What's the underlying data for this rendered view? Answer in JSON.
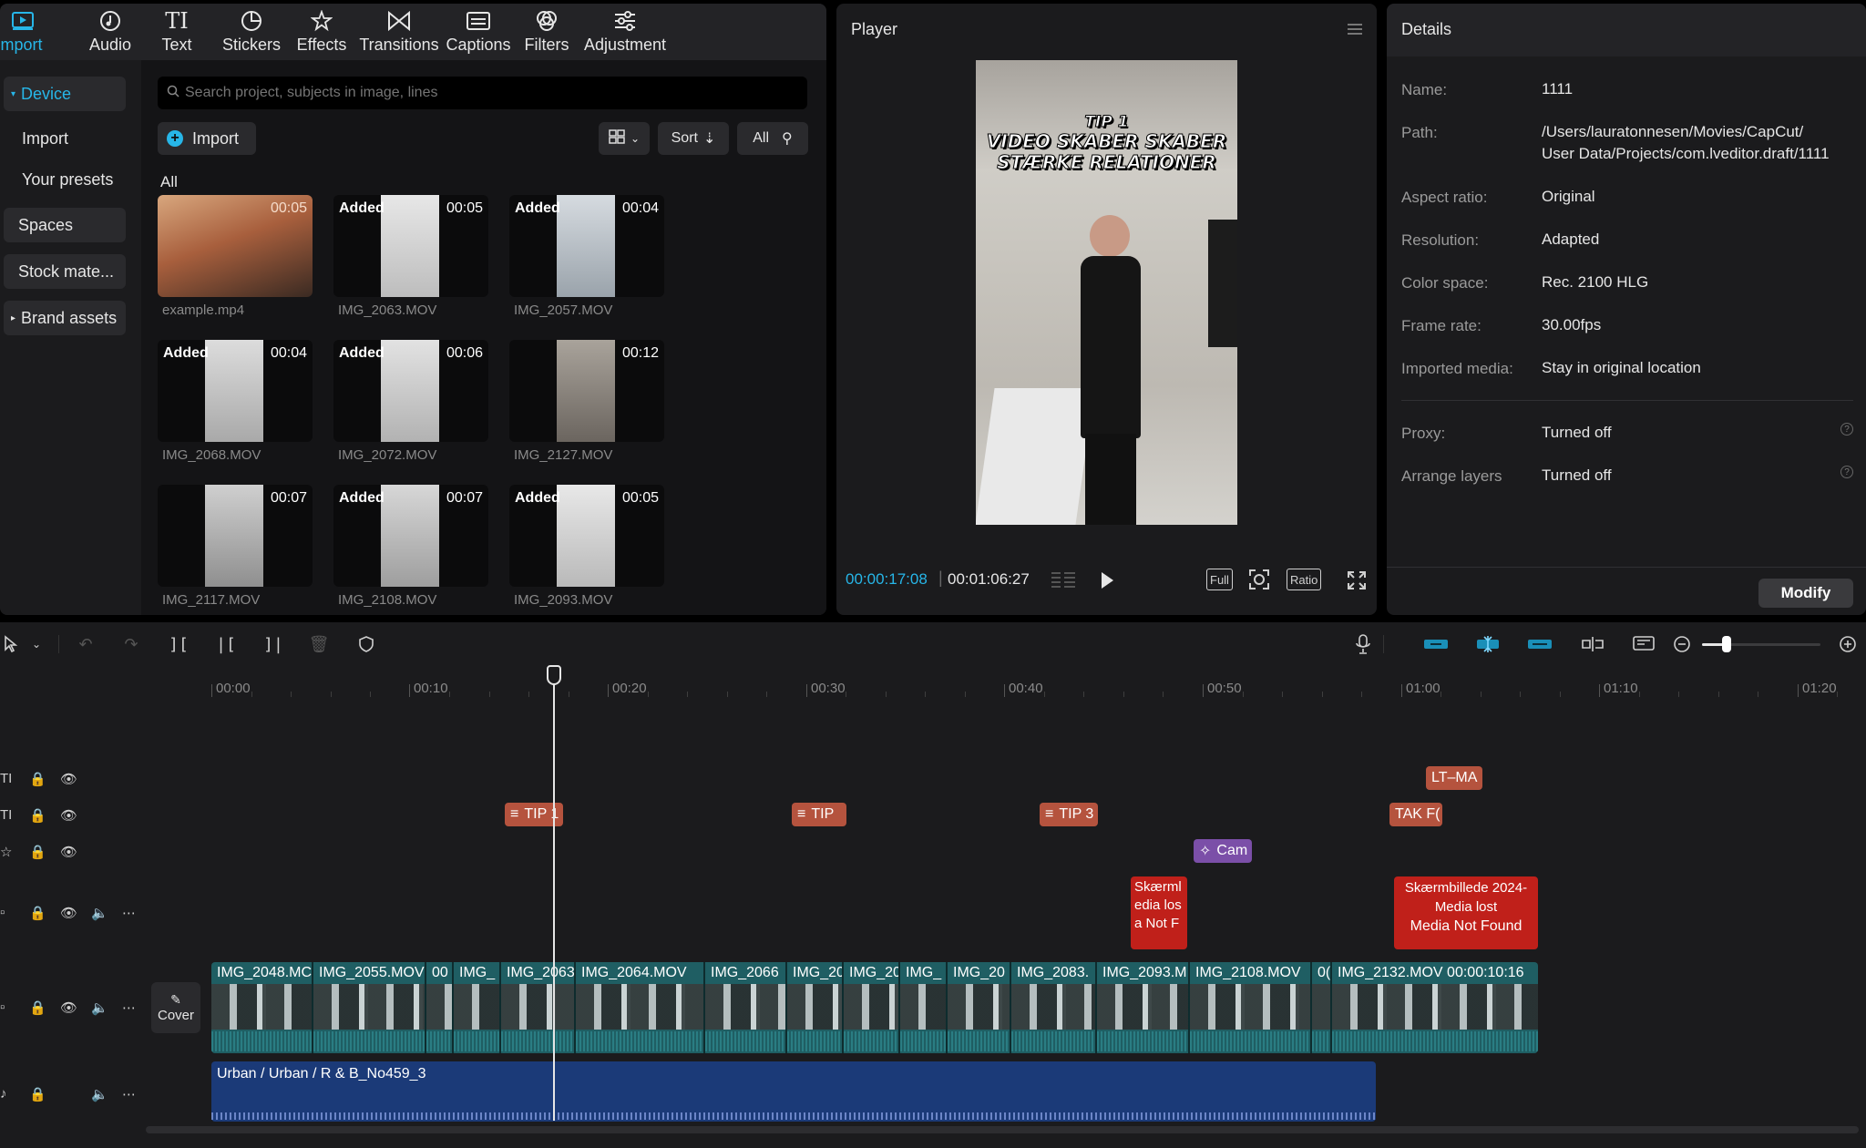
{
  "media": {
    "tabs": [
      {
        "label": "Import",
        "icon": "import-icon"
      },
      {
        "label": "Audio",
        "icon": "audio-icon"
      },
      {
        "label": "Text",
        "icon": "text-icon"
      },
      {
        "label": "Stickers",
        "icon": "stickers-icon"
      },
      {
        "label": "Effects",
        "icon": "effects-icon"
      },
      {
        "label": "Transitions",
        "icon": "transitions-icon"
      },
      {
        "label": "Captions",
        "icon": "captions-icon"
      },
      {
        "label": "Filters",
        "icon": "filters-icon"
      },
      {
        "label": "Adjustment",
        "icon": "adjustment-icon"
      }
    ],
    "sidebar": [
      "Device",
      "Import",
      "Your presets",
      "Spaces",
      "Stock mate...",
      "Brand assets"
    ],
    "search_placeholder": "Search project, subjects in image, lines",
    "import_label": "Import",
    "sort_label": "Sort",
    "all_filter": "All",
    "section_label": "All",
    "added_label": "Added",
    "items": [
      {
        "name": "example.mp4",
        "duration": "00:05",
        "added": false
      },
      {
        "name": "IMG_2063.MOV",
        "duration": "00:05",
        "added": true
      },
      {
        "name": "IMG_2057.MOV",
        "duration": "00:04",
        "added": true
      },
      {
        "name": "IMG_2068.MOV",
        "duration": "00:04",
        "added": true
      },
      {
        "name": "IMG_2072.MOV",
        "duration": "00:06",
        "added": true
      },
      {
        "name": "IMG_2127.MOV",
        "duration": "00:12",
        "added": false
      },
      {
        "name": "IMG_2117.MOV",
        "duration": "00:07",
        "added": false
      },
      {
        "name": "IMG_2108.MOV",
        "duration": "00:07",
        "added": true
      },
      {
        "name": "IMG_2093.MOV",
        "duration": "00:05",
        "added": true
      }
    ]
  },
  "player": {
    "title": "Player",
    "overlay_tip": "TIP 1",
    "overlay_line1": "VIDEO SKABER SKABER",
    "overlay_line2": "STÆRKE RELATIONER",
    "current_time": "00:00:17:08",
    "total_time": "00:01:06:27",
    "full_label": "Full",
    "ratio_label": "Ratio"
  },
  "details": {
    "title": "Details",
    "rows": [
      {
        "label": "Name:",
        "value": "1111"
      },
      {
        "label": "Path:",
        "value": "/Users/lauratonnesen/Movies/CapCut/",
        "value2": "User Data/Projects/com.lveditor.draft/1111"
      },
      {
        "label": "Aspect ratio:",
        "value": "Original"
      },
      {
        "label": "Resolution:",
        "value": "Adapted"
      },
      {
        "label": "Color space:",
        "value": "Rec. 2100 HLG"
      },
      {
        "label": "Frame rate:",
        "value": "30.00fps"
      },
      {
        "label": "Imported media:",
        "value": "Stay in original location"
      },
      {
        "label": "Proxy:",
        "value": "Turned off"
      },
      {
        "label": "Arrange layers",
        "value": "Turned off"
      }
    ],
    "modify_label": "Modify"
  },
  "timeline": {
    "ruler": [
      "00:00",
      "00:10",
      "00:20",
      "00:30",
      "00:40",
      "00:50",
      "01:00",
      "01:10",
      "01:20"
    ],
    "cover_label": "Cover",
    "text_clips_row1": [
      "LT–MA"
    ],
    "text_clips_row2": [
      "TIP 1",
      "TIP",
      "TIP 3",
      "TAK F("
    ],
    "effect_clip": "Cam",
    "missing1": {
      "l1": "Skærml",
      "l2": "edia los",
      "l3": "a Not F"
    },
    "missing2": {
      "l1": "Skærmbillede 2024-",
      "l2": "Media lost",
      "l3": "Media Not Found"
    },
    "video_clips": [
      "IMG_2048.MC",
      "IMG_2055.MOV",
      "00",
      "IMG_",
      "IMG_2063",
      "IMG_2064.MOV",
      "IMG_2066",
      "IMG_20",
      "IMG_20",
      "IMG_",
      "IMG_20",
      "IMG_2083.",
      "IMG_2093.M",
      "IMG_2108.MOV",
      "0(",
      "IMG_2132.MOV  00:00:10:16"
    ],
    "audio_label": "Urban / Urban / R & B_No459_3"
  }
}
